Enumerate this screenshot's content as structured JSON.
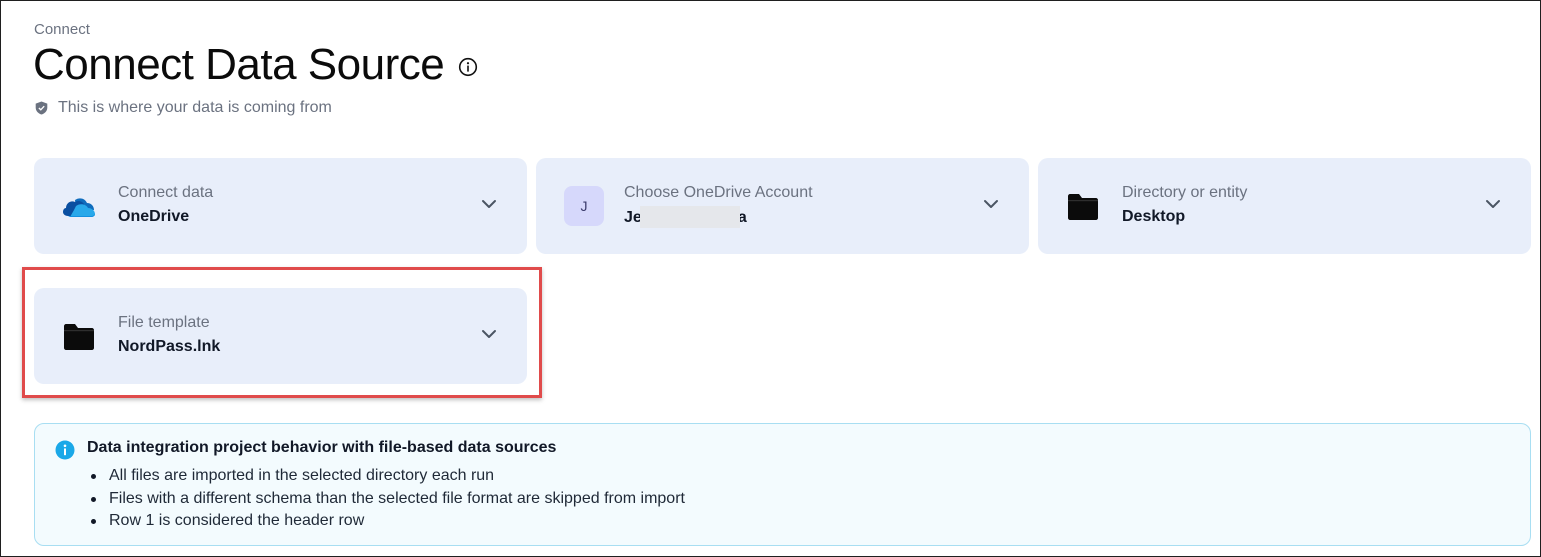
{
  "breadcrumb": "Connect",
  "page_title": "Connect Data Source",
  "subtitle": "This is where your data is coming from",
  "cards": {
    "connect": {
      "label": "Connect data",
      "value": "OneDrive",
      "icon": "onedrive-cloud-icon"
    },
    "account": {
      "label": "Choose OneDrive Account",
      "value_prefix": "J",
      "value_mid": "e",
      "value_suffix": "a",
      "avatar": "J",
      "icon": "avatar"
    },
    "directory": {
      "label": "Directory or entity",
      "value": "Desktop",
      "icon": "folder-icon"
    },
    "template": {
      "label": "File template",
      "value": "NordPass.lnk",
      "icon": "folder-icon"
    }
  },
  "notice": {
    "title": "Data integration project behavior with file-based data sources",
    "items": [
      "All files are imported in the selected directory each run",
      "Files with a different schema than the selected file format are skipped from import",
      "Row 1 is considered the header row"
    ]
  },
  "colors": {
    "card_bg": "#e8eefa",
    "highlight": "#e04b4b",
    "notice_bg": "#f3fbfe",
    "notice_border": "#a8def2",
    "info_blue": "#1aa8e8"
  }
}
